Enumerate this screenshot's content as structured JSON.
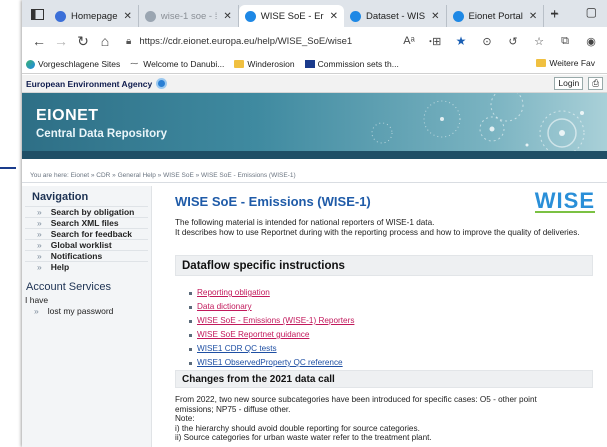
{
  "browser": {
    "tabs": [
      {
        "label": "Homepage",
        "fav_color": "#3b6fd8",
        "active": false,
        "dim": false
      },
      {
        "label": "wise-1 soe - ⁞",
        "fav_color": "#9aa5b1",
        "active": false,
        "dim": true
      },
      {
        "label": "WISE SoE - Er",
        "fav_color": "#1e88e5",
        "active": true,
        "dim": false
      },
      {
        "label": "Dataset - WIS",
        "fav_color": "#1e88e5",
        "active": false,
        "dim": false
      },
      {
        "label": "Eionet Portal",
        "fav_color": "#1e88e5",
        "active": false,
        "dim": false
      }
    ],
    "new_tab": "+",
    "url": "https://cdr.eionet.europa.eu/help/WISE_SoE/wise1",
    "window_controls": [
      "–",
      "▢"
    ]
  },
  "favorites": {
    "items": [
      {
        "label": "Vorgeschlagene Sites",
        "icon": "edge-icon"
      },
      {
        "label": "Welcome to Danubi...",
        "icon": "link-icon"
      },
      {
        "label": "Winderosion",
        "icon": "folder-icon"
      },
      {
        "label": "Commission sets th...",
        "icon": "site-icon"
      }
    ],
    "more": "Weitere Fav"
  },
  "eea": {
    "agency": "European Environment Agency",
    "login": "Login",
    "print": "⎙"
  },
  "banner": {
    "title": "EIONET",
    "subtitle": "Central Data Repository"
  },
  "breadcrumb": "You are here: Eionet » CDR » General Help » WISE SoE » WISE SoE - Emissions (WISE-1)",
  "navigation": {
    "heading": "Navigation",
    "items": [
      "Search by obligation",
      "Search XML files",
      "Search for feedback",
      "Global worklist",
      "Notifications",
      "Help"
    ]
  },
  "account": {
    "heading": "Account Services",
    "have": "I have",
    "lost": "lost my password"
  },
  "main": {
    "title": "WISE SoE - Emissions (WISE-1)",
    "logo": "WISE",
    "intro_1": "The following material is intended for national reporters of WISE-1 data.",
    "intro_2": "It describes how to use Reportnet during with the reporting process and how to improve the quality of deliveries.",
    "section_a": "Dataflow specific instructions",
    "links": [
      {
        "label": "Reporting obligation",
        "visited": true
      },
      {
        "label": "Data dictionary",
        "visited": true
      },
      {
        "label": "WISE SoE - Emissions (WISE-1) Reporters",
        "visited": true
      },
      {
        "label": "WISE SoE Reportnet guidance",
        "visited": true
      },
      {
        "label": "WISE1 CDR QC tests",
        "visited": false
      },
      {
        "label": "WISE1 ObservedProperty QC reference",
        "visited": false
      }
    ],
    "section_b": "Changes from the 2021 data call",
    "notes": [
      "From 2022, two new source subcategories have been introduced for specific cases: O5 - other point",
      "emissions; NP75 - diffuse other.",
      "Note:",
      "i) the hierarchy should avoid double reporting for source categories.",
      "ii) Source categories for urban waste water refer to the treatment plant."
    ]
  }
}
